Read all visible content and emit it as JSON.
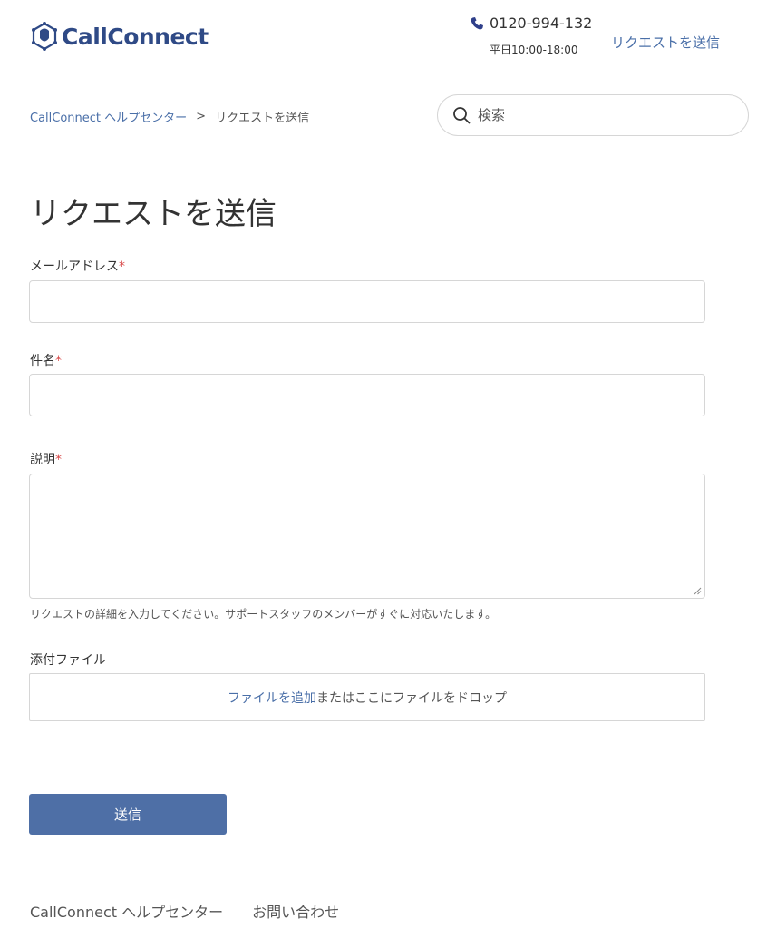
{
  "header": {
    "logo_text": "CallConnect",
    "phone_number": "0120-994-132",
    "hours": "平日10:00-18:00",
    "submit_request_link": "リクエストを送信",
    "brand_color": "#2f4a86",
    "link_color": "#4a6fa8"
  },
  "breadcrumb": {
    "home": "CallConnect ヘルプセンター",
    "separator": ">",
    "current": "リクエストを送信"
  },
  "search": {
    "placeholder": "検索",
    "value": ""
  },
  "page": {
    "title": "リクエストを送信"
  },
  "form": {
    "email": {
      "label": "メールアドレス",
      "required_mark": "*",
      "value": ""
    },
    "subject": {
      "label": "件名",
      "required_mark": "*",
      "value": ""
    },
    "description": {
      "label": "説明",
      "required_mark": "*",
      "value": "",
      "hint": "リクエストの詳細を入力してください。サポートスタッフのメンバーがすぐに対応いたします。"
    },
    "attachment": {
      "label": "添付ファイル",
      "add_link": "ファイルを追加",
      "drop_text": "またはここにファイルをドロップ"
    },
    "submit_label": "送信",
    "submit_color": "#4e6fa6",
    "required_color": "#d94a4a"
  },
  "footer": {
    "links": [
      "CallConnect ヘルプセンター",
      "お問い合わせ"
    ]
  }
}
